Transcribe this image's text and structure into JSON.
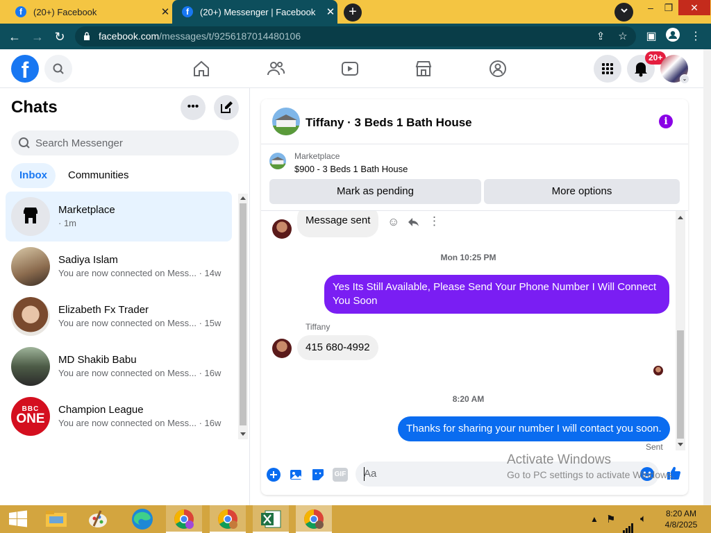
{
  "browser": {
    "tabs": [
      {
        "title": "(20+) Facebook",
        "favicon": "f"
      },
      {
        "title": "(20+) Messenger | Facebook",
        "favicon": "f"
      }
    ],
    "new_tab": "+",
    "close": "✕",
    "url_domain": "facebook.com",
    "url_path": "/messages/t/9256187014480106"
  },
  "fb": {
    "logo": "f",
    "notification_badge": "20+"
  },
  "sidebar": {
    "title": "Chats",
    "search_placeholder": "Search Messenger",
    "tabs": [
      "Inbox",
      "Communities"
    ],
    "chats": [
      {
        "name": "Marketplace",
        "snippet": "· 1m"
      },
      {
        "name": "Sadiya Islam",
        "snippet": "You are now connected on Mess... · 14w"
      },
      {
        "name": "Elizabeth Fx Trader",
        "snippet": "You are now connected on Mess... · 15w"
      },
      {
        "name": "MD Shakib Babu",
        "snippet": "You are now connected on Mess... · 16w"
      },
      {
        "name": "Champion League",
        "snippet": "You are now connected on Mess... · 16w"
      }
    ],
    "bbc_text": "BBC",
    "bbc_one": "ONE"
  },
  "conversation": {
    "title": "Tiffany · 3 Beds 1 Bath House",
    "info_icon": "i",
    "marketplace_label": "Marketplace",
    "listing": "$900 - 3 Beds 1 Bath House",
    "btn_pending": "Mark as pending",
    "btn_more": "More options",
    "messages": {
      "m1": "Message sent",
      "stamp1": "Mon 10:25 PM",
      "m2": "Yes Its Still Available, Please Send Your Phone Number I Will Connect You Soon",
      "sender": "Tiffany",
      "m3": "415 680-4992",
      "stamp2": "8:20 AM",
      "m4": "Thanks for sharing your number I will contact you soon.",
      "status": "Sent"
    },
    "composer_placeholder": "Aa",
    "gif": "GIF"
  },
  "watermark": {
    "line1": "Activate Windows",
    "line2": "Go to PC settings to activate Windows."
  },
  "taskbar": {
    "time": "8:20 AM",
    "date": "4/8/2025"
  },
  "colors": {
    "tabstrip": "#f4c542",
    "chrome_toolbar": "#0d4e5c",
    "fb_blue": "#1877f2",
    "purple_bubble": "#7a1ef3",
    "blue_bubble": "#0a6cf0",
    "taskbar": "#d3a53f"
  }
}
